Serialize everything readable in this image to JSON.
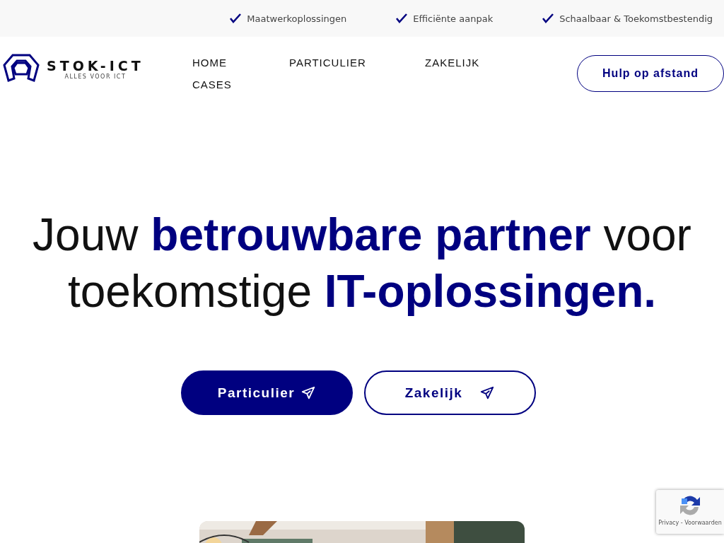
{
  "topbar": {
    "items": [
      {
        "label": "Maatwerkoplossingen"
      },
      {
        "label": "Efficiënte aanpak"
      },
      {
        "label": "Schaalbaar & Toekomstbestendig"
      }
    ]
  },
  "header": {
    "logo": {
      "name": "STOK-ICT",
      "tagline": "ALLES VOOR ICT"
    },
    "nav": [
      {
        "label": "HOME"
      },
      {
        "label": "PARTICULIER"
      },
      {
        "label": "ZAKELIJK"
      },
      {
        "label": "CASES"
      }
    ],
    "cta": "Hulp op afstand"
  },
  "hero": {
    "headline": "Jouw **betrouwbare partner** voor toekomstige **IT-oplossingen.**",
    "buttons": [
      {
        "label": "Particulier",
        "kind": "filled"
      },
      {
        "label": "Zakelijk",
        "kind": "outline"
      }
    ]
  },
  "recaptcha": {
    "links": "Privacy - Voorwaarden"
  }
}
